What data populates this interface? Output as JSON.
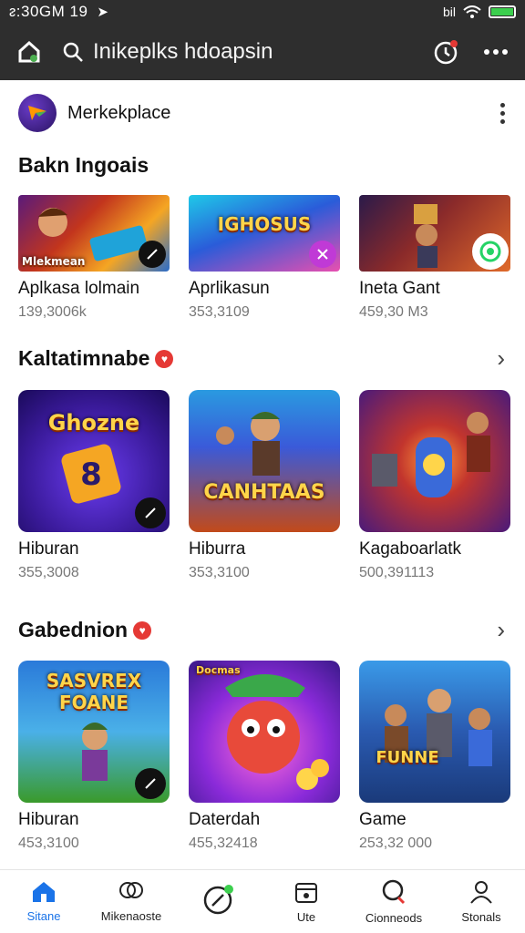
{
  "status_bar": {
    "time": "ᴤ:30GM 19",
    "signal_label": "bil"
  },
  "app_bar": {
    "title": "Inikeplks hdoapsin"
  },
  "marketplace": {
    "name": "Merkekplace"
  },
  "sections": [
    {
      "title": "Bakn Ingoais",
      "items": [
        {
          "label": "Aplkasa lolmain",
          "meta": "139,3006k",
          "thumb_text": "Mlekmean"
        },
        {
          "label": "Aprlikasun",
          "meta": "353,3109",
          "thumb_text": "IGHOSUS"
        },
        {
          "label": "Ineta Gant",
          "meta": "459,30 M3",
          "thumb_text": ""
        }
      ]
    },
    {
      "title": "Kaltatimnabe",
      "items": [
        {
          "label": "Hiburan",
          "meta": "355,3008",
          "thumb_text": "Ghozne"
        },
        {
          "label": "Hiburra",
          "meta": "353,3100",
          "thumb_text": "CANHTAAS"
        },
        {
          "label": "Kagaboarlatk",
          "meta": "500,391113",
          "thumb_text": ""
        }
      ]
    },
    {
      "title": "Gabednion",
      "items": [
        {
          "label": "Hiburan",
          "meta": "453,3100",
          "thumb_text": "SASVREX FOANE"
        },
        {
          "label": "Daterdah",
          "meta": "455,32418",
          "thumb_text": "Docmas"
        },
        {
          "label": "Game",
          "meta": "253,32 000",
          "thumb_text": "FUNNE"
        }
      ]
    }
  ],
  "bottom_nav": [
    {
      "label": "Sitane",
      "icon": "home-icon",
      "active": true
    },
    {
      "label": "Mikenaoste",
      "icon": "community-icon",
      "active": false
    },
    {
      "label": "",
      "icon": "compass-icon",
      "active": false
    },
    {
      "label": "Ute",
      "icon": "calendar-icon",
      "active": false
    },
    {
      "label": "Cionneods",
      "icon": "search-icon",
      "active": false
    },
    {
      "label": "Stonals",
      "icon": "profile-icon",
      "active": false
    }
  ],
  "colors": {
    "bar": "#2e2e2e",
    "accent": "#1a73e8",
    "heart": "#e53935"
  }
}
